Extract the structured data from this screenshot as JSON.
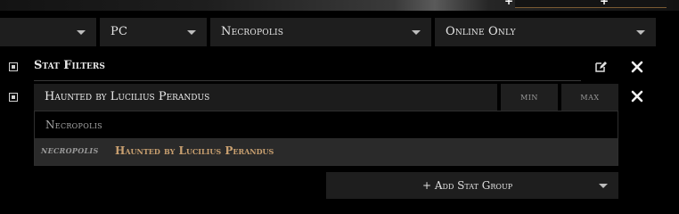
{
  "filters": {
    "first_select": {
      "value": ""
    },
    "platform_select": {
      "value": "PC"
    },
    "league_select": {
      "value": "Necropolis"
    },
    "status_select": {
      "value": "Online Only"
    }
  },
  "stat_filters": {
    "title": "Stat Filters",
    "row": {
      "label": "Haunted by Lucilius Perandus",
      "min_label": "min",
      "max_label": "max"
    },
    "dropdown": {
      "header": "Necropolis",
      "item_tag": "NECROPOLIS",
      "item_label": "Haunted by Lucilius Perandus"
    },
    "add_group_label": "+ Add Stat Group"
  },
  "colors": {
    "accent_gold": "#c9a070"
  }
}
